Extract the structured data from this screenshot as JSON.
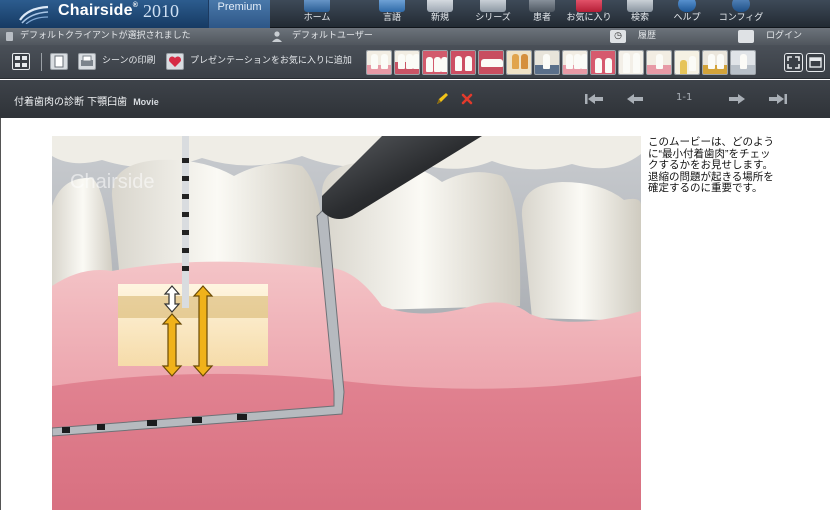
{
  "app": {
    "brand": "Chairside",
    "trademark": "®",
    "year": "2010",
    "edition": "Premium"
  },
  "nav": {
    "home": "ホーム",
    "language": "言語",
    "new": "新規",
    "series": "シリーズ",
    "patient": "患者",
    "favorites": "お気に入り",
    "search": "検索",
    "help": "ヘルプ",
    "config": "コンフィグ"
  },
  "status": {
    "client": "デフォルトクライアントが選択されました",
    "user": "デフォルトユーザー",
    "history": "履歴",
    "login": "ログイン"
  },
  "toolbar": {
    "print_scene": "シーンの印刷",
    "add_presentation_favorite": "プレゼンテーションをお気に入りに追加"
  },
  "movie": {
    "title": "付着歯肉の診断 下顎臼歯",
    "type": "Movie",
    "page": "1-1"
  },
  "video": {
    "watermark": "Chairside"
  },
  "description": "このムービーは、どのように“最小付着歯肉”をチェックするかをお見せします。退縮の問題が起きる場所を確定するのに重要です。",
  "colors": {
    "header_blue": "#2c5c8e",
    "toolbar_gray": "#3a3f46",
    "gum_pink": "#e79aa6",
    "arrow_gold": "#f0b21a",
    "edit_yellow": "#f2c318",
    "close_red": "#e23a2c"
  }
}
